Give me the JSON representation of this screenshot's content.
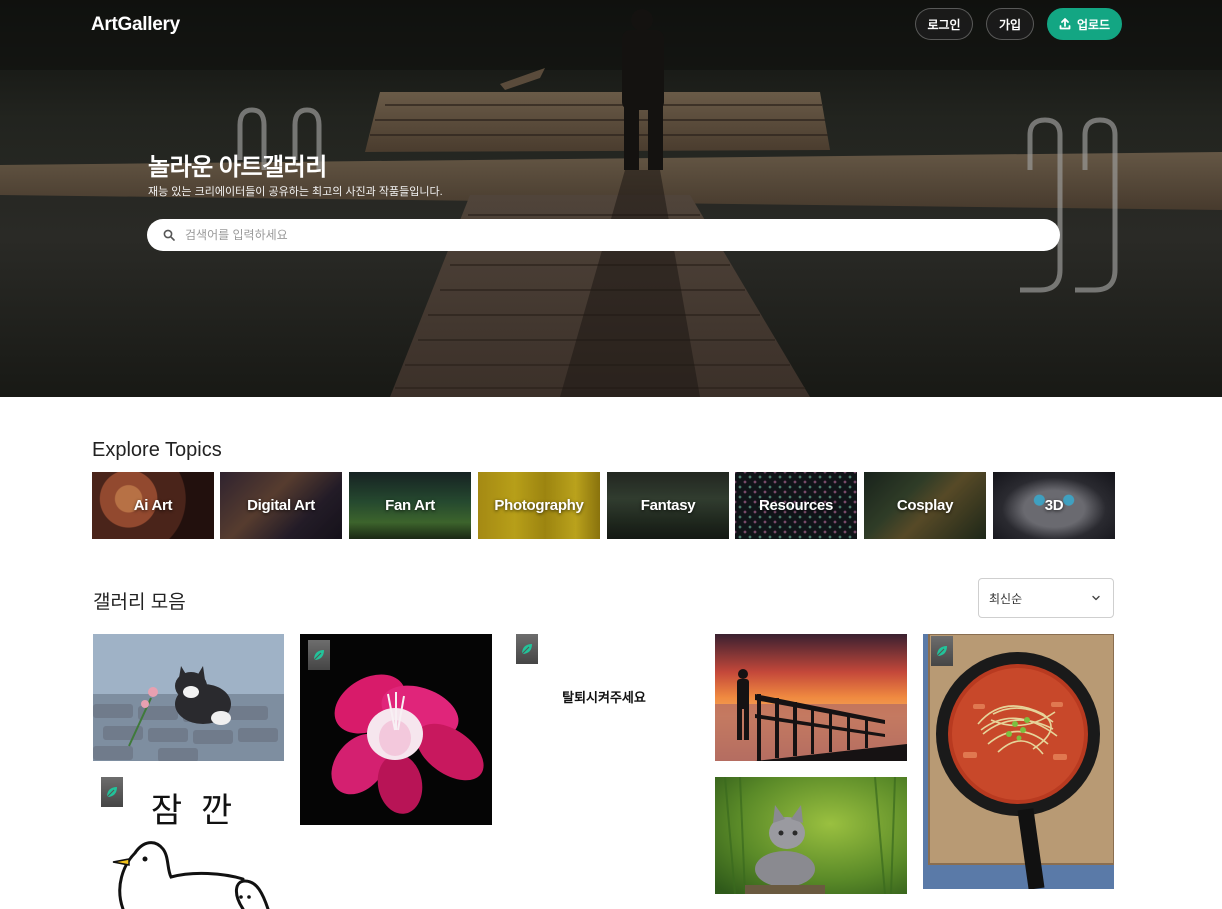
{
  "app": {
    "logo": "ArtGallery"
  },
  "header": {
    "login_label": "로그인",
    "join_label": "가입",
    "upload_label": "업로드"
  },
  "hero": {
    "title": "놀라운 아트갤러리",
    "subtitle": "재능 있는 크리에이터들이 공유하는 최고의 사진과 작품들입니다.",
    "search_placeholder": "검색어를 입력하세요"
  },
  "topics": {
    "title": "Explore Topics",
    "items": [
      {
        "label": "Ai Art"
      },
      {
        "label": "Digital Art"
      },
      {
        "label": "Fan Art"
      },
      {
        "label": "Photography"
      },
      {
        "label": "Fantasy"
      },
      {
        "label": "Resources"
      },
      {
        "label": "Cosplay"
      },
      {
        "label": "3D"
      }
    ]
  },
  "gallery": {
    "title": "갤러리 모음",
    "sort_selected": "최신순",
    "cards": [
      {
        "name": "kitten-flower"
      },
      {
        "name": "doodle-bird",
        "text": "잠 깐"
      },
      {
        "name": "pink-flower"
      },
      {
        "name": "text-card",
        "text": "탈퇴시켜주세요"
      },
      {
        "name": "sunset-pier"
      },
      {
        "name": "kitten-grass"
      },
      {
        "name": "food-noodles"
      }
    ]
  },
  "colors": {
    "accent": "#13a683",
    "badge": "#555555"
  },
  "icons": {
    "upload": "upload-icon",
    "search": "search-icon",
    "chevron": "chevron-down-icon",
    "leaf": "leaf-icon"
  }
}
